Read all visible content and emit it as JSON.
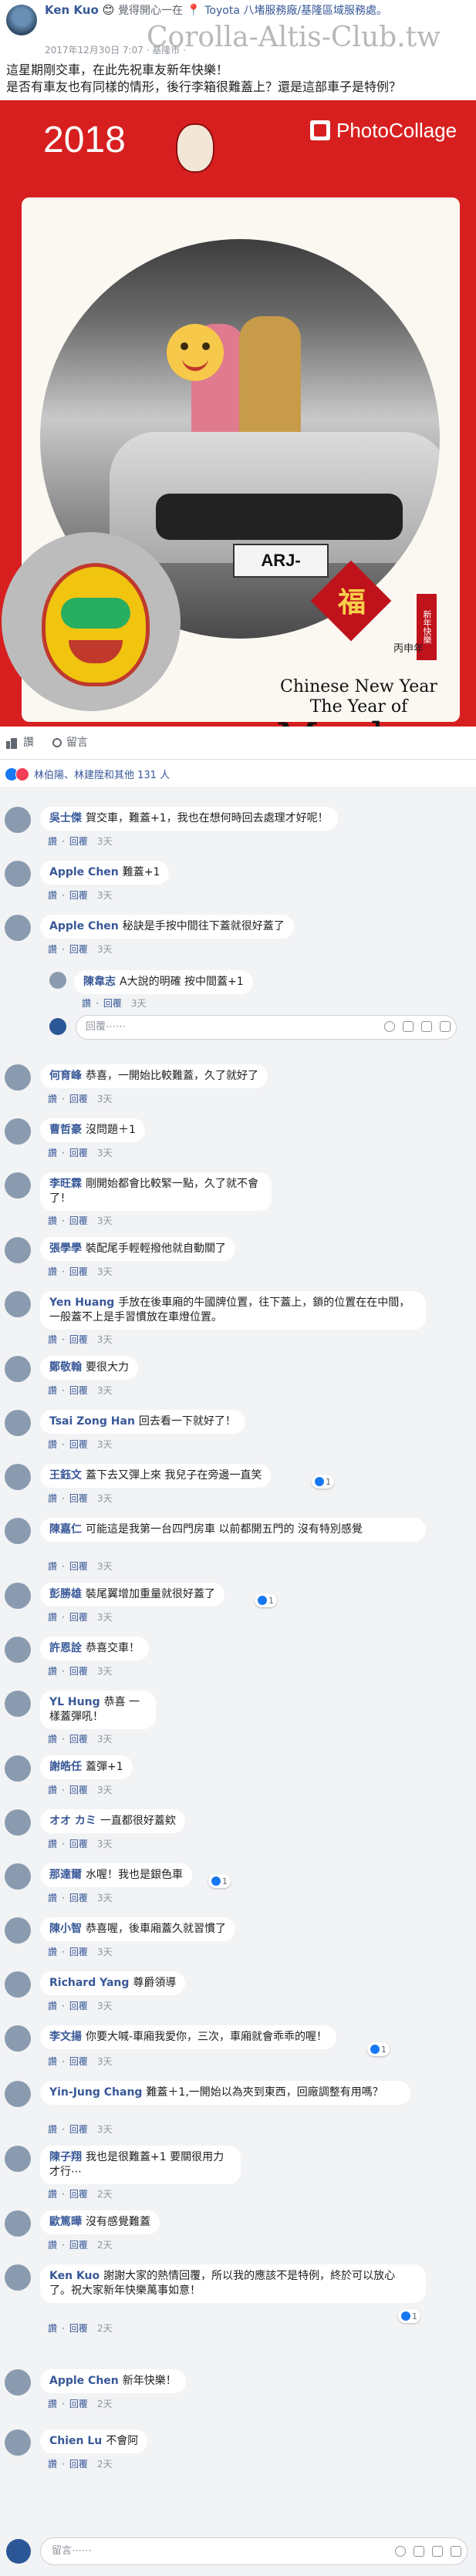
{
  "post": {
    "author": "Ken Kuo",
    "feeling": "覺得開心",
    "at_prefix": "一在",
    "place": "Toyota 八堵服務廠/基隆區域服務處。",
    "timestamp": "2017年12月30日 7:07 · 基隆市 ·",
    "body_line1": "這星期剛交車，在此先祝車友新年快樂！",
    "body_line2": "是否有車友也有同樣的情形，後行李箱很難蓋上？還是這部車子是特例？",
    "watermark": "Corolla-Altis-Club.tw"
  },
  "photo": {
    "year": "2018",
    "badge": "PhotoCollage",
    "plate": "ARJ-",
    "fu": "福",
    "seal_text": "新年快樂",
    "small_text": "丙申年",
    "line1": "Chinese New Year",
    "line2": "The Year of",
    "monkey": "Monkey"
  },
  "actions": {
    "like": "讚",
    "comment": "留言"
  },
  "reactions": {
    "text": "林伯陽、林建陞和其他 131 人"
  },
  "meta_labels": {
    "like": "讚",
    "reply": "回覆"
  },
  "comments": [
    {
      "name": "吳士傑",
      "text": "賀交車，難蓋+1，我也在想何時回去處理才好呢！",
      "time": "3天"
    },
    {
      "name": "Apple Chen",
      "text": "難蓋+1",
      "time": "3天"
    },
    {
      "name": "Apple Chen",
      "text": "秘訣是手按中間往下蓋就很好蓋了",
      "time": "3天"
    },
    {
      "name": "陳韋志",
      "text": "A大說的明確 按中間蓋+1",
      "time": "3天"
    },
    {
      "name": "何育峰",
      "text": "恭喜，一開始比較難蓋，久了就好了",
      "time": "3天"
    },
    {
      "name": "曹哲豪",
      "text": "沒問題＋1",
      "time": "3天"
    },
    {
      "name": "李旺霖",
      "text": "剛開始都會比較緊一點，久了就不會了！",
      "time": "3天"
    },
    {
      "name": "張學學",
      "text": "裝配尾手輕輕撥他就自動關了",
      "time": "3天"
    },
    {
      "name": "Yen Huang",
      "text": "手放在後車廂的牛國牌位置，往下蓋上，鎖的位置在在中間，一般蓋不上是手習慣放在車燈位置。",
      "time": "3天"
    },
    {
      "name": "鄭敬翰",
      "text": "要很大力",
      "time": "3天"
    },
    {
      "name": "Tsai Zong Han",
      "text": "回去看一下就好了！",
      "time": "3天"
    },
    {
      "name": "王鈺文",
      "text": "蓋下去又彈上來 我兒子在旁邊一直笑",
      "time": "3天",
      "react": "1"
    },
    {
      "name": "陳嘉仁",
      "text": "可能這是我第一台四門房車 以前都開五門的 沒有特別感覺",
      "time": "3天"
    },
    {
      "name": "彭勝雄",
      "text": "裝尾翼增加重量就很好蓋了",
      "time": "3天",
      "react": "1"
    },
    {
      "name": "許恩詮",
      "text": "恭喜交車！",
      "time": "3天"
    },
    {
      "name": "YL Hung",
      "text": "恭喜 一樣蓋彈吼！",
      "time": "3天"
    },
    {
      "name": "謝皓任",
      "text": "蓋彈+1",
      "time": "3天"
    },
    {
      "name": "オオ カミ",
      "text": "一直都很好蓋欸",
      "time": "3天"
    },
    {
      "name": "那達爾",
      "text": "水喔！我也是銀色車",
      "time": "3天",
      "react": "1"
    },
    {
      "name": "陳小智",
      "text": "恭喜喔，後車廂蓋久就習慣了",
      "time": "3天"
    },
    {
      "name": "Richard Yang",
      "text": "尊爵領導",
      "time": "3天"
    },
    {
      "name": "李文揚",
      "text": "你要大喊-車廂我愛你，三次，車廂就會乖乖的喔！",
      "time": "3天",
      "react": "1"
    },
    {
      "name": "Yin-Jung Chang",
      "text": "難蓋＋1,一開始以為夾到東西，回廠調整有用嗎？",
      "time": "3天"
    },
    {
      "name": "陳子翔",
      "text": "我也是很難蓋+1 要關很用力才行⋯",
      "time": "2天"
    },
    {
      "name": "歐篤曄",
      "text": "沒有感覺難蓋",
      "time": "2天"
    },
    {
      "name": "Ken Kuo",
      "text": "謝謝大家的熱情回覆，所以我的應該不是特例，終於可以放心了。祝大家新年快樂萬事如意！",
      "time": "2天",
      "react": "1"
    },
    {
      "name": "Apple Chen",
      "text": "新年快樂！",
      "time": "2天"
    },
    {
      "name": "Chien Lu",
      "text": "不會阿",
      "time": "2天"
    }
  ],
  "reply_input_placeholder": "回覆⋯⋯",
  "comment_input_placeholder": "留言⋯⋯"
}
